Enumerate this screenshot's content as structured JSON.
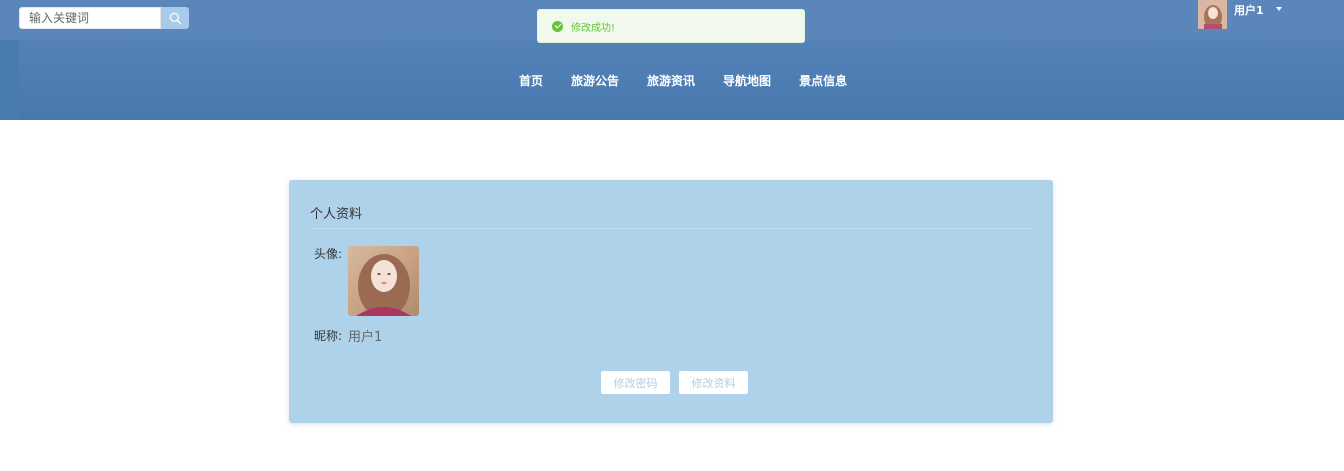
{
  "search": {
    "placeholder": "输入关键词"
  },
  "toast": {
    "message": "修改成功!"
  },
  "user": {
    "name": "用户1"
  },
  "nav": {
    "items": [
      "首页",
      "旅游公告",
      "旅游资讯",
      "导航地图",
      "景点信息"
    ]
  },
  "profile": {
    "title": "个人资料",
    "avatar_label": "头像:",
    "nickname_label": "昵称:",
    "nickname_value": "用户1"
  },
  "buttons": {
    "change_password": "修改密码",
    "edit_profile": "修改资料"
  },
  "colors": {
    "header_top": "#5b86bc",
    "header_nav": "#4a7bb0",
    "card_bg": "#afd2eb",
    "toast_bg": "#f0f9eb",
    "toast_text": "#67c23a"
  }
}
